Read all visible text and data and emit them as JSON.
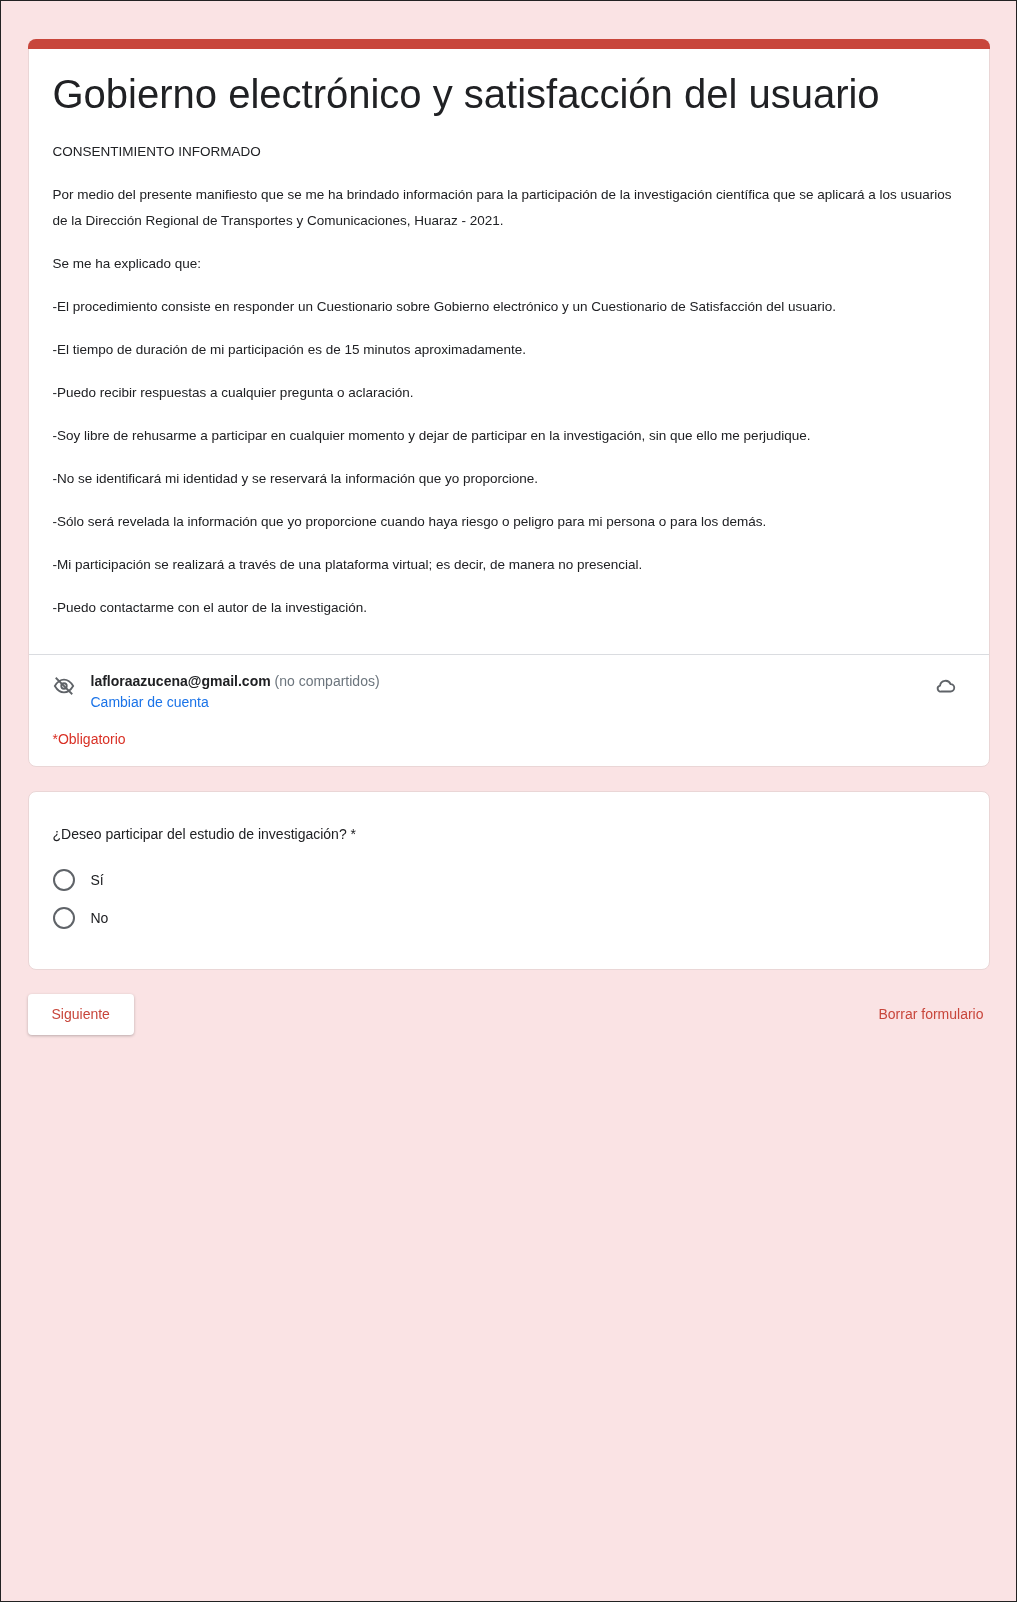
{
  "form": {
    "title": "Gobierno electrónico y satisfacción del usuario",
    "paragraphs": [
      "CONSENTIMIENTO INFORMADO",
      "Por medio del presente manifiesto que se me ha brindado información para la participación de la investigación científica que se aplicará a los usuarios de la Dirección Regional de Transportes y Comunicaciones, Huaraz - 2021.",
      "Se me ha explicado que:",
      "-El procedimiento consiste en responder un Cuestionario sobre Gobierno electrónico y un Cuestionario de Satisfacción del usuario.",
      "-El tiempo de duración de mi participación es de 15 minutos aproximadamente.",
      "-Puedo recibir respuestas a cualquier pregunta o aclaración.",
      "-Soy libre de rehusarme a participar en cualquier momento y dejar de participar en la investigación, sin que ello me perjudique.",
      "-No se identificará mi identidad y se reservará la información que yo proporcione.",
      "-Sólo será revelada la información que yo proporcione cuando haya riesgo o peligro para mi persona o para los demás.",
      "-Mi participación se realizará a través de una plataforma virtual; es decir, de manera no presencial.",
      "-Puedo contactarme con el autor de la investigación."
    ],
    "account": {
      "email": "lafloraazucena@gmail.com",
      "note": "(no compartidos)",
      "switch_link": "Cambiar de cuenta"
    },
    "required_note": "*Obligatorio"
  },
  "question": {
    "text": "¿Deseo participar del estudio de investigación?",
    "required_mark": "*",
    "options": [
      {
        "label": "Sí",
        "selected": false
      },
      {
        "label": "No",
        "selected": false
      }
    ]
  },
  "buttons": {
    "next": "Siguiente",
    "clear": "Borrar formulario"
  }
}
